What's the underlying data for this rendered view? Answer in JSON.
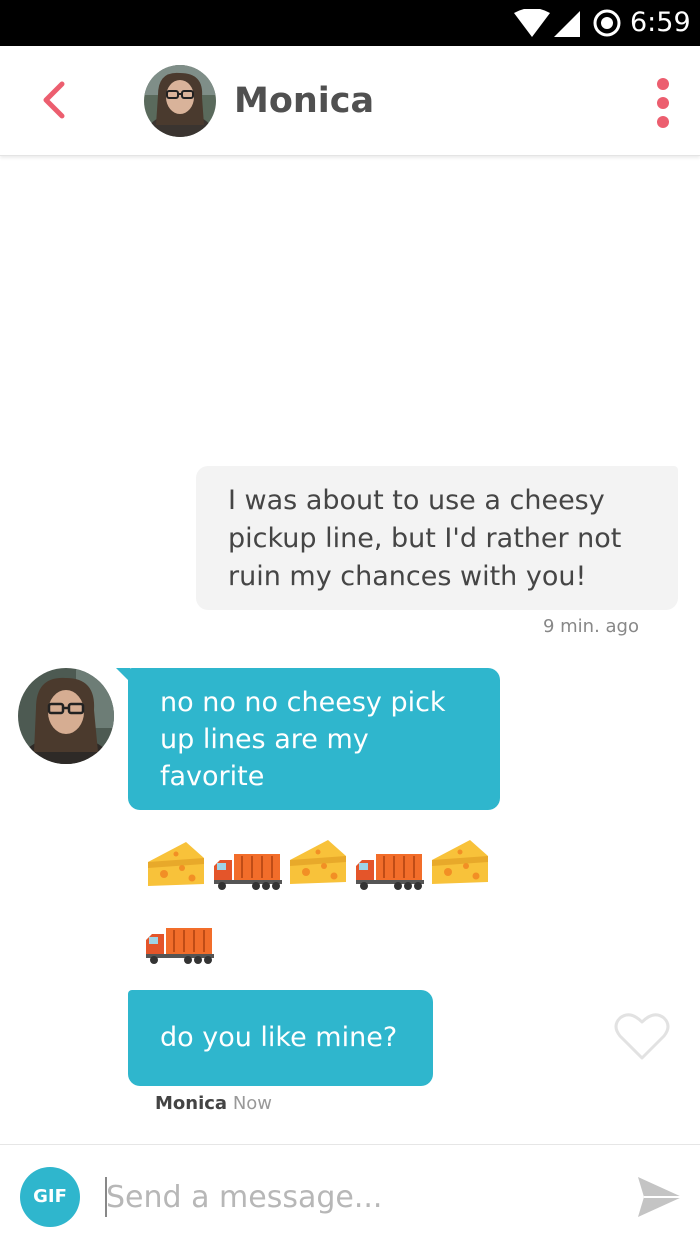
{
  "status_bar": {
    "time": "6:59",
    "icons": [
      "wifi-icon",
      "cell-signal-icon",
      "alarm-icon"
    ]
  },
  "header": {
    "contact_name": "Monica",
    "back_icon": "chevron-left-icon",
    "menu_icon": "more-vertical-icon"
  },
  "messages": [
    {
      "direction": "outgoing",
      "text": "I was about to use a cheesy pickup line, but I'd rather not ruin my chances with you!",
      "time": "9 min. ago"
    },
    {
      "direction": "incoming",
      "text": "no no no cheesy pick up lines are my favorite"
    },
    {
      "direction": "incoming",
      "type": "emoji",
      "emoji": [
        "cheese",
        "truck",
        "cheese",
        "truck",
        "cheese",
        "truck"
      ]
    },
    {
      "direction": "incoming",
      "text": "do you like mine?",
      "sender": "Monica",
      "time": "Now"
    }
  ],
  "composer": {
    "gif_label": "GIF",
    "placeholder": "Send a message...",
    "send_icon": "send-icon"
  },
  "colors": {
    "accent": "#2fb6cd",
    "back_red": "#ec5e6f",
    "bubble_out": "#f3f3f3"
  }
}
